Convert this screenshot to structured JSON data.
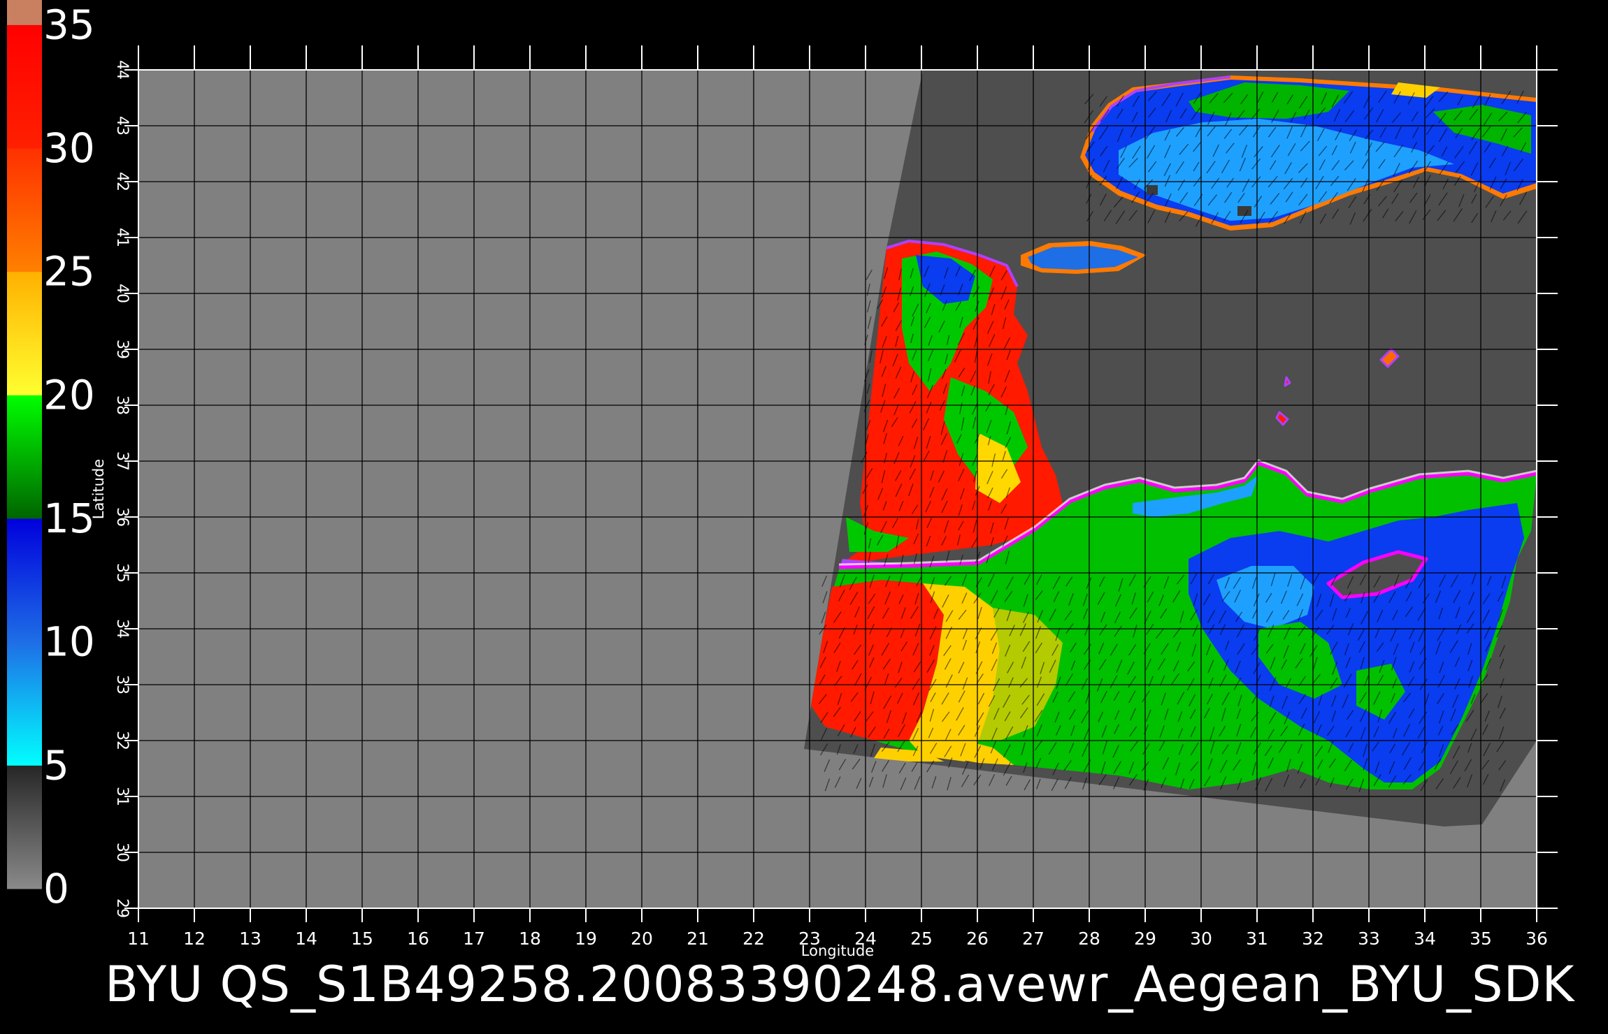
{
  "colorbar": {
    "tick_labels": [
      "35",
      "30",
      "25",
      "20",
      "15",
      "10",
      "5",
      "0"
    ],
    "segments": [
      {
        "from": 0,
        "to": 5,
        "colors": [
          "#8a8a8a",
          "#262626"
        ]
      },
      {
        "from": 5,
        "to": 10,
        "colors": [
          "#00ffff",
          "#1e6ee6"
        ]
      },
      {
        "from": 10,
        "to": 15,
        "colors": [
          "#1e6ee6",
          "#0000dc"
        ]
      },
      {
        "from": 15,
        "to": 20,
        "colors": [
          "#006400",
          "#00ff00"
        ]
      },
      {
        "from": 20,
        "to": 25,
        "colors": [
          "#ffff30",
          "#ffb000"
        ]
      },
      {
        "from": 25,
        "to": 30,
        "colors": [
          "#ff8000",
          "#ff3000"
        ]
      },
      {
        "from": 30,
        "to": 35,
        "colors": [
          "#ff2000",
          "#ff0000"
        ]
      },
      {
        "from": 35,
        "to": 36,
        "colors": [
          "#c88060",
          "#c88060"
        ]
      }
    ]
  },
  "axes": {
    "xlabel": "Longitude",
    "ylabel": "Latitude",
    "lon_ticks": [
      "11",
      "12",
      "13",
      "14",
      "15",
      "16",
      "17",
      "18",
      "19",
      "20",
      "21",
      "22",
      "23",
      "24",
      "25",
      "26",
      "27",
      "28",
      "29",
      "30",
      "31",
      "32",
      "33",
      "34",
      "35",
      "36"
    ],
    "lat_ticks": [
      "29",
      "30",
      "31",
      "32",
      "33",
      "34",
      "35",
      "36",
      "37",
      "38",
      "39",
      "40",
      "41",
      "42",
      "43",
      "44"
    ],
    "lon_range": [
      11,
      36
    ],
    "lat_range": [
      29,
      44
    ],
    "grid": true
  },
  "colors": {
    "no_data": "#808080",
    "land": "#4e4e4e",
    "grid": "#000000"
  },
  "footer": {
    "title": "BYU QS_S1B49258.20083390248.avewr_Aegean_BYU_SDK"
  }
}
